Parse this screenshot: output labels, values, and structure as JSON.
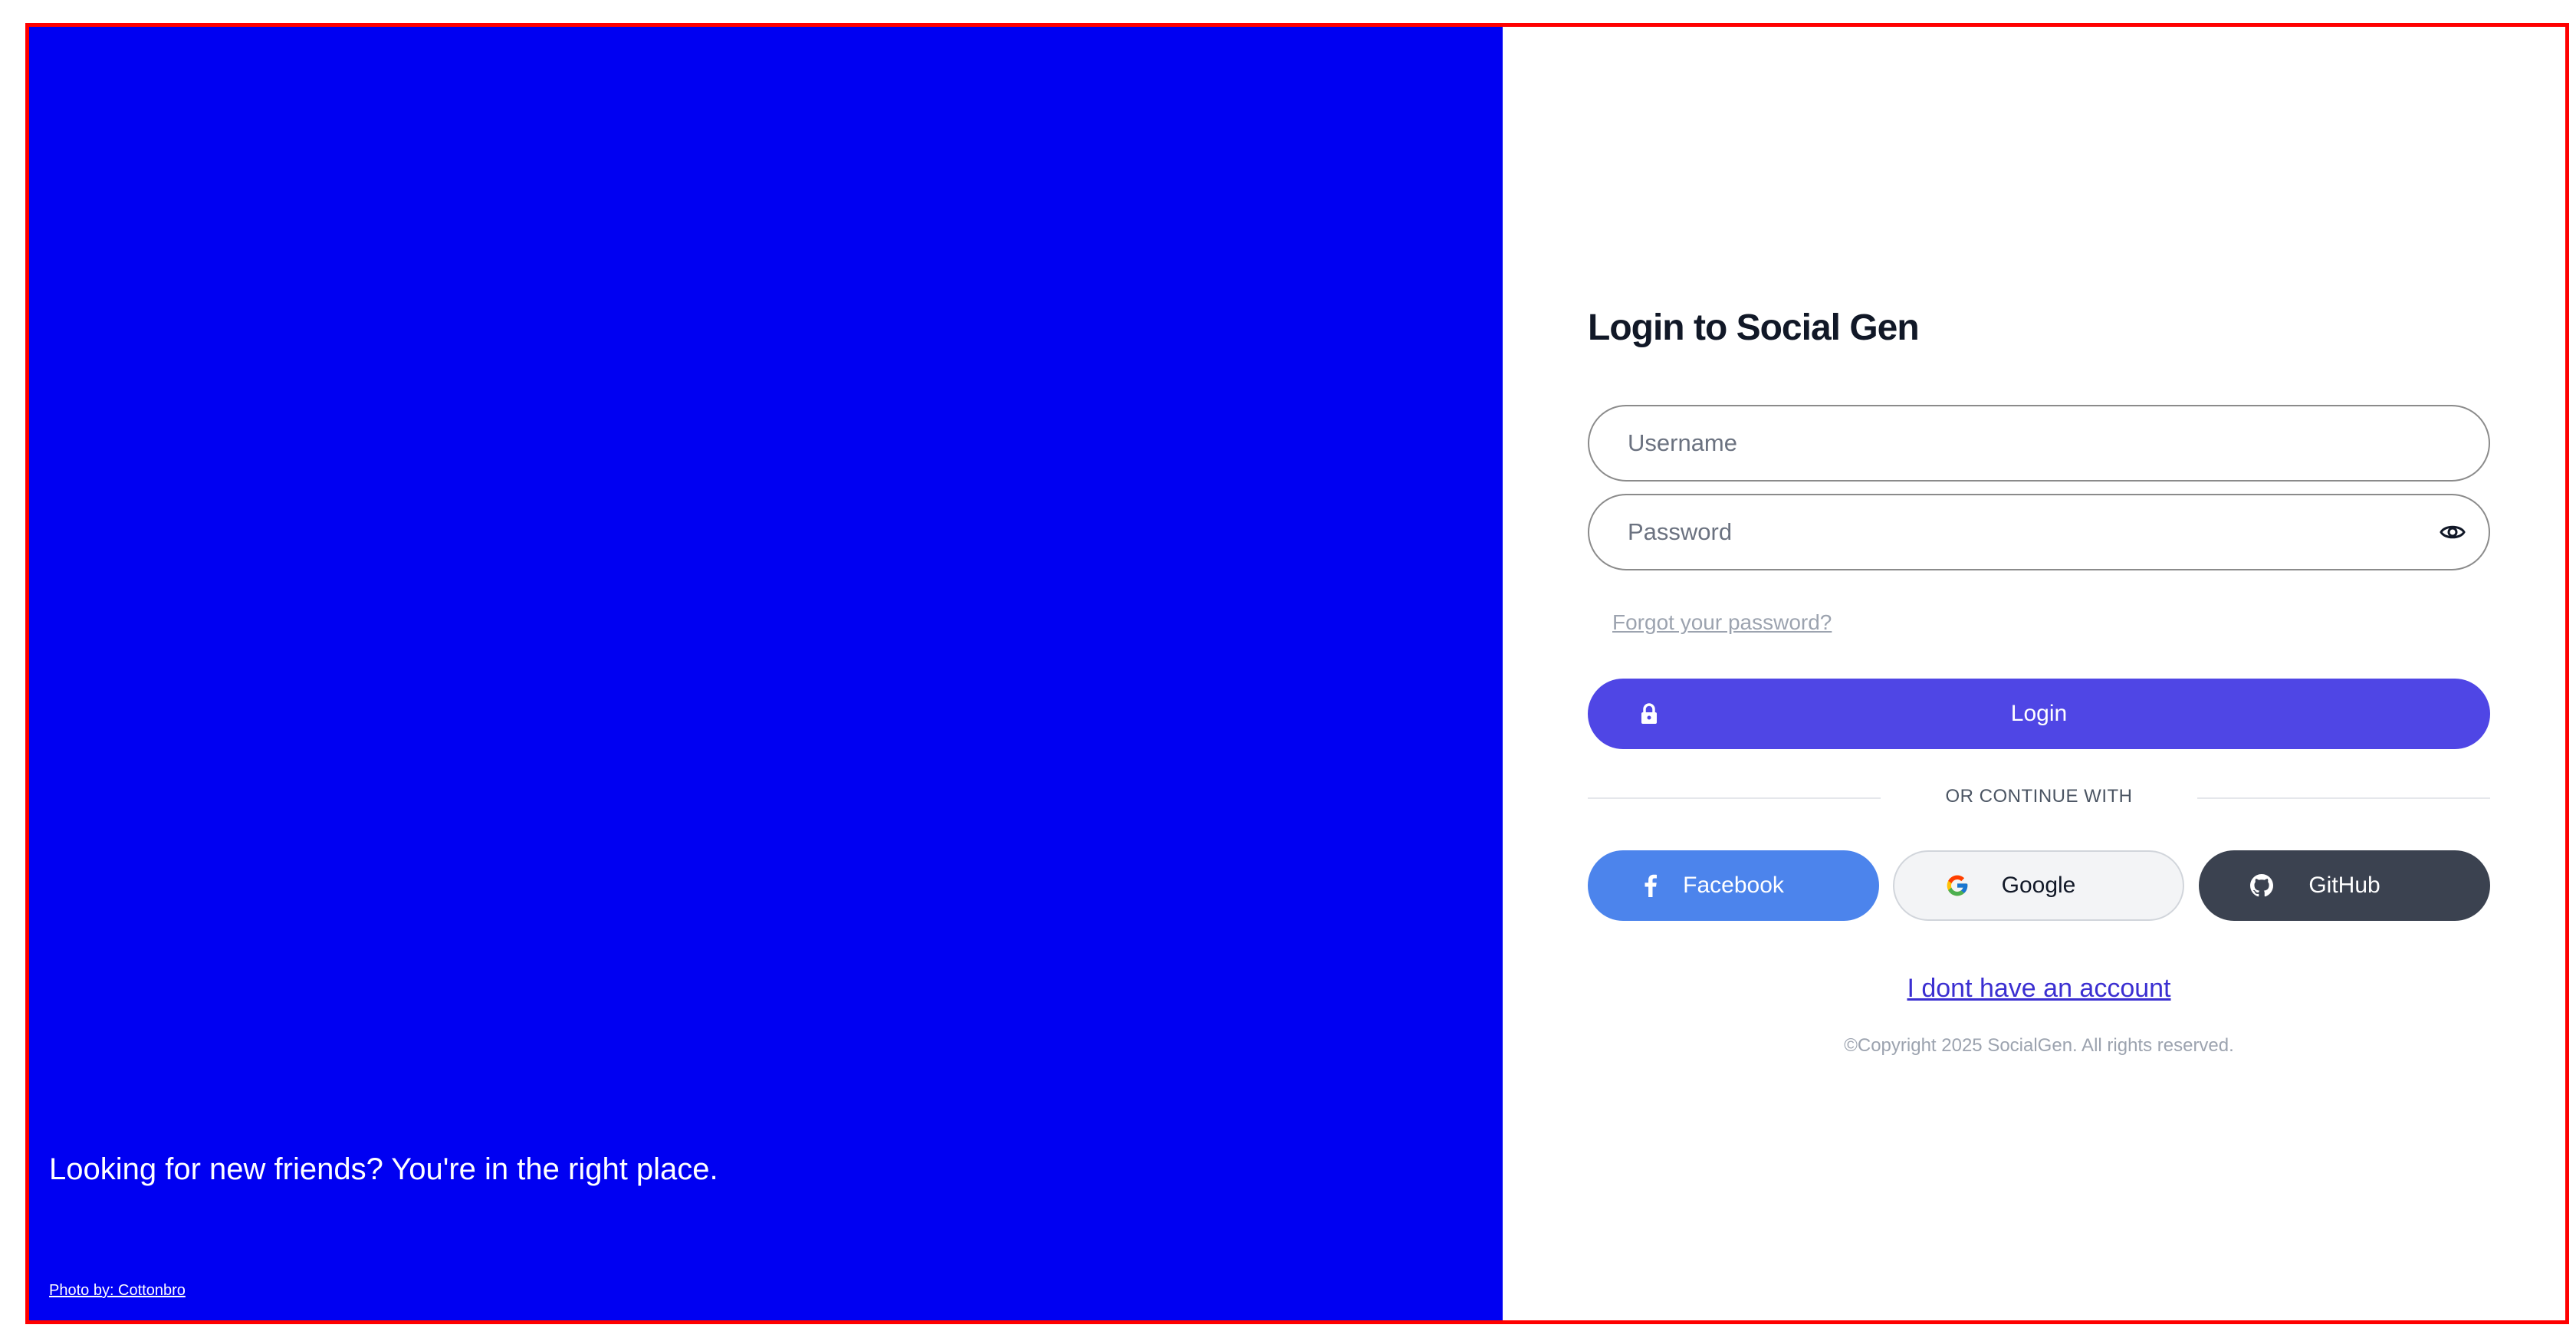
{
  "hero": {
    "tagline": "Looking for new friends? You're in the right place.",
    "photo_credit": "Photo by: Cottonbro",
    "background_color": "#0000f2"
  },
  "login": {
    "title": "Login to Social Gen",
    "username_placeholder": "Username",
    "password_placeholder": "Password",
    "forgot_password": "Forgot your password?",
    "login_button": "Login",
    "divider_text": "OR CONTINUE WITH",
    "social": {
      "facebook": "Facebook",
      "google": "Google",
      "github": "GitHub"
    },
    "no_account_link": "I dont have an account",
    "copyright": "©Copyright 2025 SocialGen. All rights reserved."
  },
  "colors": {
    "accent": "#4f46e5",
    "facebook": "#4c84ec",
    "github": "#3b4250",
    "frame": "#ff0000"
  },
  "icons": {
    "password_toggle": "eye-icon",
    "login": "lock-icon",
    "facebook": "facebook-icon",
    "google": "google-icon",
    "github": "github-icon"
  }
}
